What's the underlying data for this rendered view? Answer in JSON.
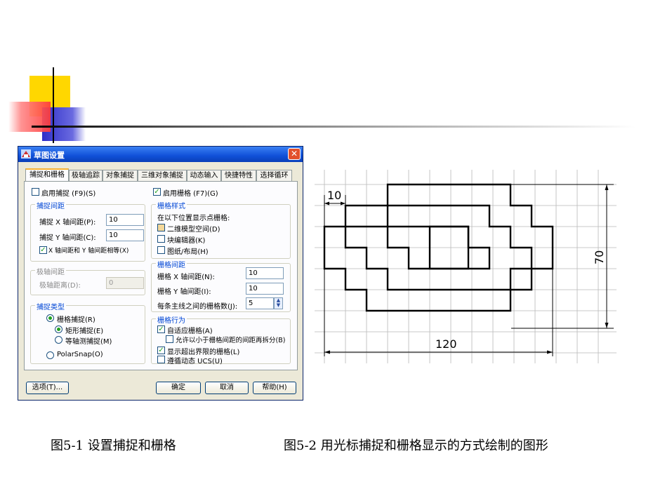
{
  "dialog": {
    "title": "草图设置",
    "tabs": [
      "捕捉和栅格",
      "极轴追踪",
      "对象捕捉",
      "三维对象捕捉",
      "动态输入",
      "快捷特性",
      "选择循环"
    ],
    "snap_enable_label": "启用捕捉 (F9)(S)",
    "grid_enable_label": "启用栅格 (F7)(G)",
    "snap_spacing": {
      "title": "捕捉间距",
      "x_label": "捕捉 X 轴间距(P):",
      "x_value": "10",
      "y_label": "捕捉 Y 轴间距(C):",
      "y_value": "10",
      "equal_label": "X 轴间距和 Y 轴间距相等(X)"
    },
    "polar_spacing": {
      "title": "极轴间距",
      "dist_label": "极轴距离(D):",
      "dist_value": "0"
    },
    "snap_type": {
      "title": "捕捉类型",
      "grid_snap": "栅格捕捉(R)",
      "rect_snap": "矩形捕捉(E)",
      "iso_snap": "等轴测捕捉(M)",
      "polar_snap": "PolarSnap(O)"
    },
    "grid_style": {
      "title": "栅格样式",
      "intro": "在以下位置显示点栅格:",
      "model": "二维模型空间(D)",
      "block": "块编辑器(K)",
      "layout": "图纸/布局(H)"
    },
    "grid_spacing": {
      "title": "栅格间距",
      "x_label": "栅格 X 轴间距(N):",
      "x_value": "10",
      "y_label": "栅格 Y 轴间距(I):",
      "y_value": "10",
      "major_label": "每条主线之间的栅格数(J):",
      "major_value": "5"
    },
    "grid_behavior": {
      "title": "栅格行为",
      "adaptive": "自适应栅格(A)",
      "subdivide": "允许以小于栅格间距的间距再拆分(B)",
      "beyond": "显示超出界限的栅格(L)",
      "follow_ucs": "遵循动态 UCS(U)"
    },
    "buttons": {
      "options": "选项(T)...",
      "ok": "确定",
      "cancel": "取消",
      "help": "帮助(H)"
    }
  },
  "drawing": {
    "dim_top": "10",
    "dim_bottom": "120",
    "dim_right": "70"
  },
  "captions": {
    "left": "图5-1  设置捕捉和栅格",
    "right": "图5-2  用光标捕捉和栅格显示的方式绘制的图形"
  },
  "colors": {
    "title_bar": "#1050d8",
    "accent_yellow": "#ffd700",
    "accent_blue": "#3535d0",
    "accent_red": "#ff4040"
  }
}
